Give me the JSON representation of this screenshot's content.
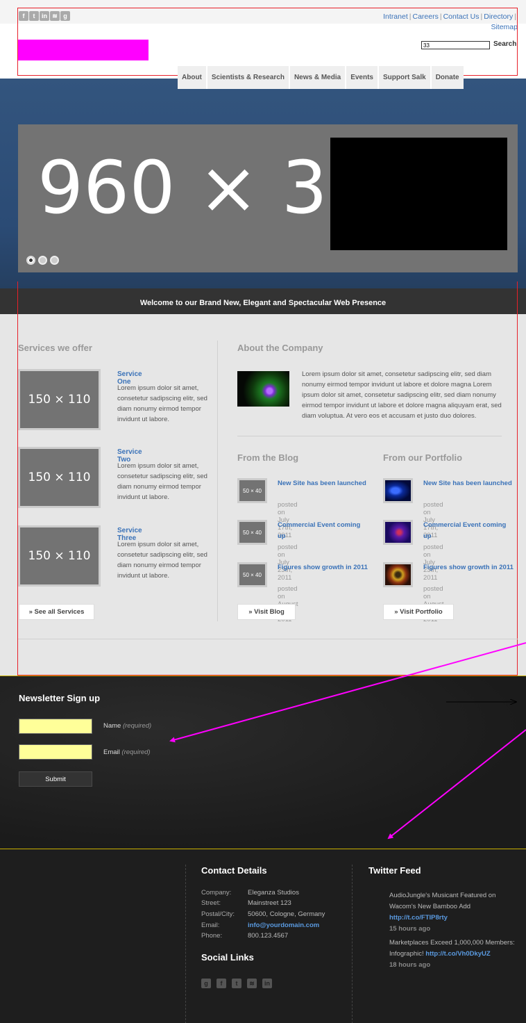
{
  "header": {
    "social_icons": [
      {
        "icon": "facebook-icon",
        "glyph": "f"
      },
      {
        "icon": "twitter-icon",
        "glyph": "t"
      },
      {
        "icon": "linkedin-icon",
        "glyph": "in"
      },
      {
        "icon": "rss-icon",
        "glyph": "≋"
      },
      {
        "icon": "google-icon",
        "glyph": "g"
      }
    ],
    "util_links": [
      "Intranet",
      "Careers",
      "Contact Us",
      "Directory",
      "Sitemap"
    ],
    "util_sep": "|",
    "search_value": "33",
    "search_label": "Search",
    "logo_color": "#ff00ff"
  },
  "nav": [
    "About",
    "Scientists & Research",
    "News & Media",
    "Events",
    "Support Salk",
    "Donate"
  ],
  "hero": {
    "placeholder_text": "960 × 3",
    "slide_count": 3,
    "active_slide": 1
  },
  "welcome": "Welcome to our Brand New, Elegant and Spectacular Web Presence",
  "services": {
    "title": "Services we offer",
    "items": [
      {
        "placeholder": "150 × 110",
        "title": "Service One",
        "text": "Lorem ipsum dolor sit amet, consetetur sadipscing elitr, sed diam nonumy eirmod tempor invidunt ut labore."
      },
      {
        "placeholder": "150 × 110",
        "title": "Service Two",
        "text": "Lorem ipsum dolor sit amet, consetetur sadipscing elitr, sed diam nonumy eirmod tempor invidunt ut labore."
      },
      {
        "placeholder": "150 × 110",
        "title": "Service Three",
        "text": "Lorem ipsum dolor sit amet, consetetur sadipscing elitr, sed diam nonumy eirmod tempor invidunt ut labore."
      }
    ],
    "button": "» See all Services"
  },
  "about": {
    "title": "About the Company",
    "text": "Lorem ipsum dolor sit amet, consetetur sadipscing elitr, sed diam nonumy eirmod tempor invidunt ut labore et dolore magna Lorem ipsum dolor sit amet, consetetur sadipscing elitr, sed diam nonumy eirmod tempor invidunt ut labore et dolore magna aliquyam erat, sed diam voluptua. At vero eos et accusam et justo duo dolores."
  },
  "blog": {
    "title": "From the Blog",
    "posts": [
      {
        "placeholder": "50 × 40",
        "title": "New Site has been launched",
        "date": "posted on July 17th, 2011"
      },
      {
        "placeholder": "50 × 40",
        "title": "Commercial Event coming up",
        "date": "posted on July 23th, 2011"
      },
      {
        "placeholder": "50 × 40",
        "title": "Figures show growth in 2011",
        "date": "posted on August 3rd, 2011"
      }
    ],
    "button": "» Visit Blog"
  },
  "portfolio": {
    "title": "From our Portfolio",
    "posts": [
      {
        "title": "New Site has been launched",
        "date": "posted on July 17th, 2011"
      },
      {
        "title": "Commercial Event coming up",
        "date": "posted on July 23th, 2011"
      },
      {
        "title": "Figures show growth in 2011",
        "date": "posted on August 3rd, 2011"
      }
    ],
    "button": "» Visit Portfolio"
  },
  "newsletter": {
    "title": "Newsletter Sign up",
    "name_label": "Name",
    "email_label": "Email",
    "required": "(required)",
    "submit": "Submit",
    "field_color": "#ffff99",
    "annotation_color": "#ff00ff"
  },
  "footer": {
    "contact_title": "Contact Details",
    "contact": [
      {
        "k": "Company:",
        "v": "Eleganza Studios"
      },
      {
        "k": "Street:",
        "v": "Mainstreet 123"
      },
      {
        "k": "Postal/City:",
        "v": "50600, Cologne, Germany"
      },
      {
        "k": "Email:",
        "v": "info@yourdomain.com"
      },
      {
        "k": "Phone:",
        "v": "800.123.4567"
      }
    ],
    "social_title": "Social Links",
    "social_icons": [
      {
        "icon": "google-icon",
        "glyph": "g"
      },
      {
        "icon": "facebook-icon",
        "glyph": "f"
      },
      {
        "icon": "twitter-icon",
        "glyph": "t"
      },
      {
        "icon": "rss-icon",
        "glyph": "≋"
      },
      {
        "icon": "linkedin-icon",
        "glyph": "in"
      }
    ],
    "twitter_title": "Twitter Feed",
    "tweets": [
      {
        "text": "AudioJungle's Musicant Featured on Wacom's New Bamboo Add",
        "link": "http://t.co/FTIP8rty",
        "time": "15 hours ago"
      },
      {
        "text": "Marketplaces Exceed 1,000,000 Members: Infographic!",
        "link": "http://t.co/Vh0DkyUZ",
        "time": "18 hours ago"
      }
    ]
  }
}
